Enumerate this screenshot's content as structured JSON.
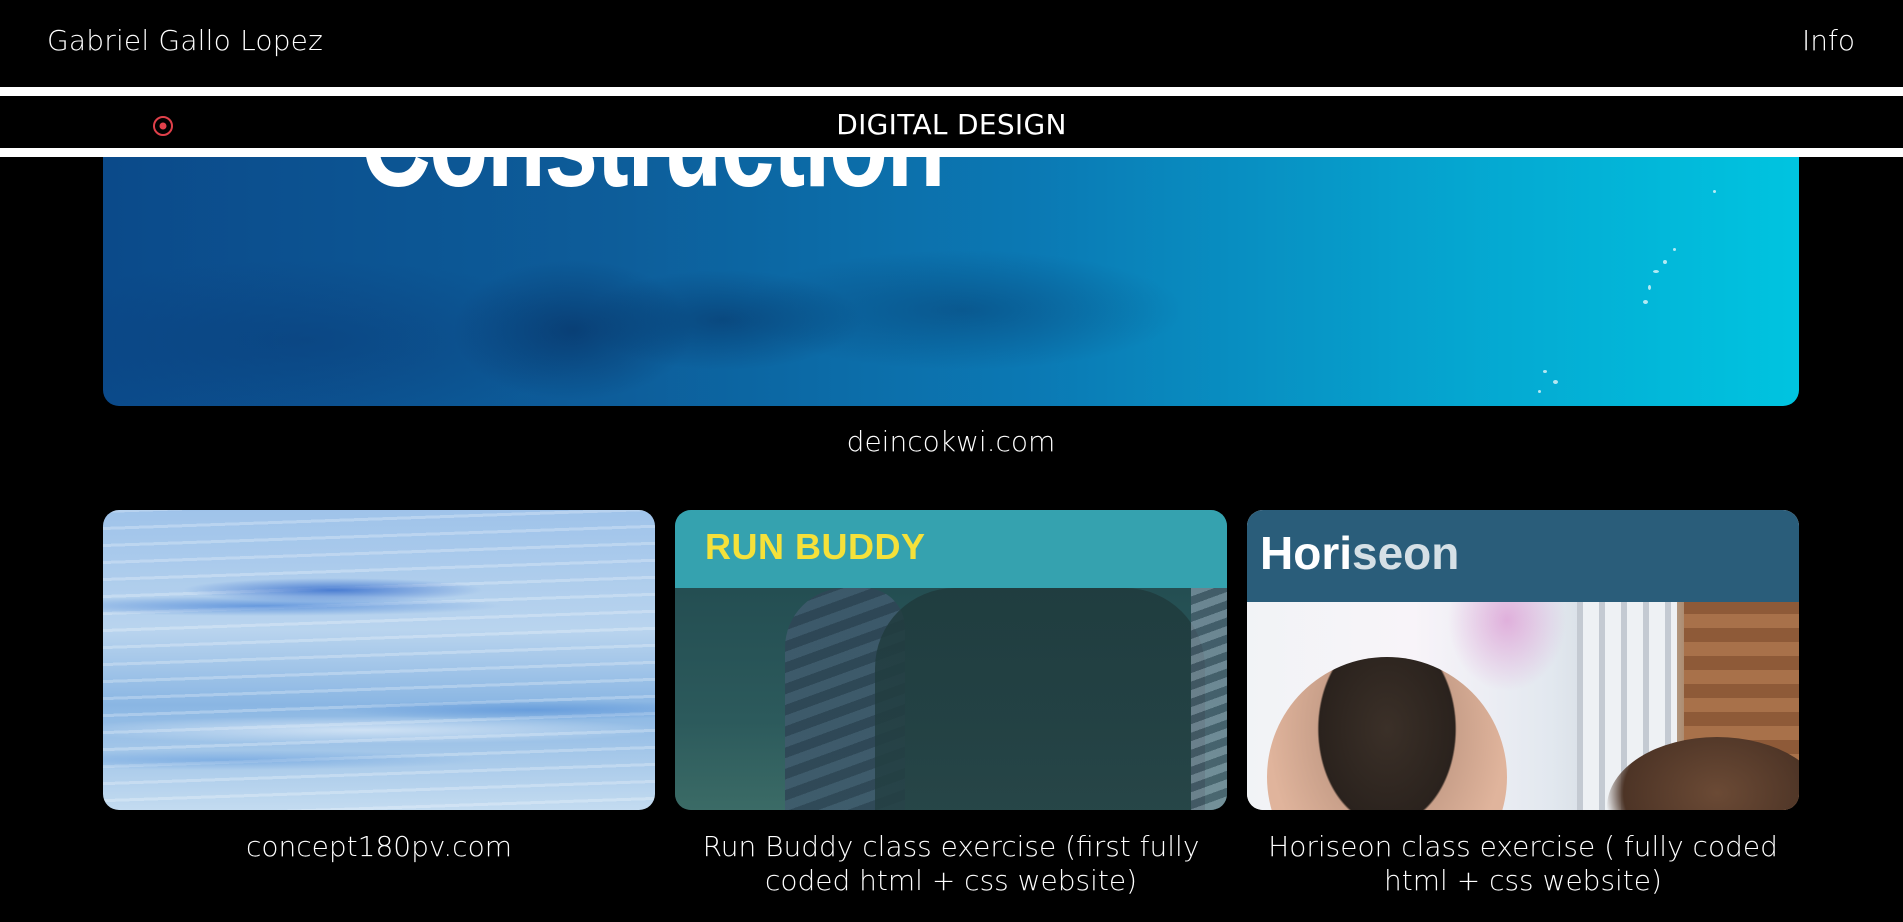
{
  "header": {
    "brand": "Gabriel Gallo Lopez",
    "info_link": "Info"
  },
  "section": {
    "title": "DIGITAL DESIGN",
    "icon": "target-icon",
    "icon_color": "#e0404a"
  },
  "hero": {
    "image_text": "Construction",
    "caption": "deincokwi.com"
  },
  "cards": [
    {
      "image": "sky-clouds",
      "caption": "concept180pv.com"
    },
    {
      "image_text": "RUN BUDDY",
      "caption_line1": "Run Buddy class exercise (first fully",
      "caption_line2": "coded html + css website)"
    },
    {
      "image_text_a": "Hori",
      "image_text_b": "seon",
      "caption_line1": "Horiseon class exercise ( fully coded",
      "caption_line2": "html + css website)"
    }
  ],
  "colors": {
    "background": "#000000",
    "run_buddy_yellow": "#f5e13a",
    "run_buddy_teal": "#35a2af",
    "horiseon_blue": "#2a5d7a"
  }
}
